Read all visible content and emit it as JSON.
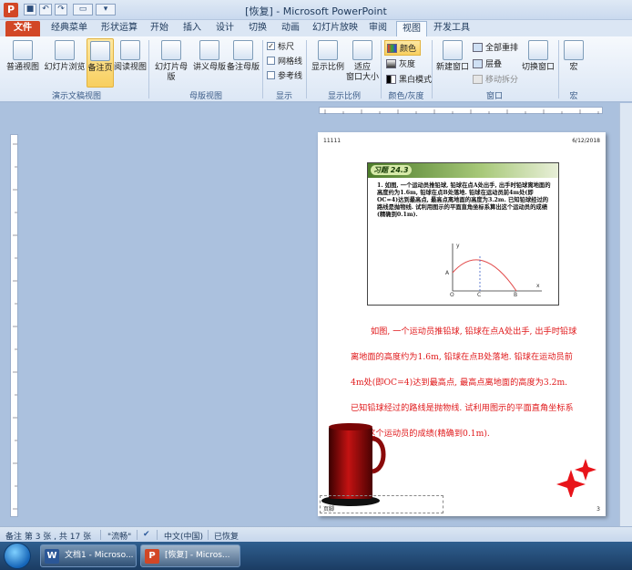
{
  "window": {
    "title": "[恢复] - Microsoft PowerPoint",
    "app_icon_letter": "P"
  },
  "tabs": [
    {
      "label": "文件"
    },
    {
      "label": "经典菜单"
    },
    {
      "label": "形状运算"
    },
    {
      "label": "开始"
    },
    {
      "label": "插入"
    },
    {
      "label": "设计"
    },
    {
      "label": "切换"
    },
    {
      "label": "动画"
    },
    {
      "label": "幻灯片放映"
    },
    {
      "label": "审阅"
    },
    {
      "label": "视图"
    },
    {
      "label": "开发工具"
    }
  ],
  "ribbon": {
    "groups": {
      "presentation_views": "演示文稿视图",
      "master_views": "母版视图",
      "show": "显示",
      "zoom": "显示比例",
      "color": "颜色/灰度",
      "window": "窗口",
      "macros": "宏"
    },
    "buttons": {
      "normal": "普通视图",
      "slide_sorter": "幻灯片浏览",
      "notes_page": "备注页",
      "reading": "阅读视图",
      "slide_master": "幻灯片母版",
      "handout_master": "讲义母版",
      "notes_master": "备注母版",
      "zoom": "显示比例",
      "fit_window": "适应",
      "fit_window2": "窗口大小",
      "color": "颜色",
      "grayscale": "灰度",
      "bw": "黑白模式",
      "new_window": "新建窗口",
      "arrange_all": "全部重排",
      "cascade": "层叠",
      "move_split": "移动拆分",
      "switch_window": "切换窗口",
      "macros": "宏"
    },
    "checks": {
      "ruler": "标尺",
      "gridlines": "网格线",
      "guides": "参考线"
    }
  },
  "page": {
    "header_left": "11111",
    "header_right": "6/12/2018",
    "page_number": "3",
    "footer_label": "页脚",
    "slide_badge": "习题 24.3",
    "slide_text": "1. 如图, 一个运动员推铅球, 铅球在点A处出手, 出手时铅球离地面的高度约为1.6m, 铅球在点B处落地. 铅球在运动员前4m处(即OC=4)达到最高点, 最高点离地面的高度为3.2m. 已知铅球经过的路线是抛物线. 试利用图示的平面直角坐标系算出这个运动员的成绩 (精确到0.1m).",
    "graph_labels": {
      "y": "y",
      "x": "x",
      "a": "A",
      "o": "O",
      "c": "C",
      "b": "B"
    },
    "notes_text": "如图, 一个运动员推铅球, 铅球在点A处出手, 出手时铅球离地面的高度约为1.6m, 铅球在点B处落地. 铅球在运动员前4m处(即OC=4)达到最高点, 最高点离地面的高度为3.2m. 已知铅球经过的路线是抛物线. 试利用图示的平面直角坐标系算出这个运动员的成绩(精确到0.1m)."
  },
  "statusbar": {
    "page_info": "备注 第 3 张 , 共 17 张",
    "theme": "\"流畅\"",
    "language": "中文(中国)",
    "recovered": "已恢复"
  },
  "taskbar": {
    "items": [
      {
        "label": "文档1 - Microso...",
        "icon": "W"
      },
      {
        "label": "[恢复] - Micros...",
        "icon": "P"
      }
    ]
  },
  "colors": {
    "accent_file_tab": "#d24726",
    "notes_text": "#e0191b",
    "ribbon_bg": "#dce7f5"
  }
}
